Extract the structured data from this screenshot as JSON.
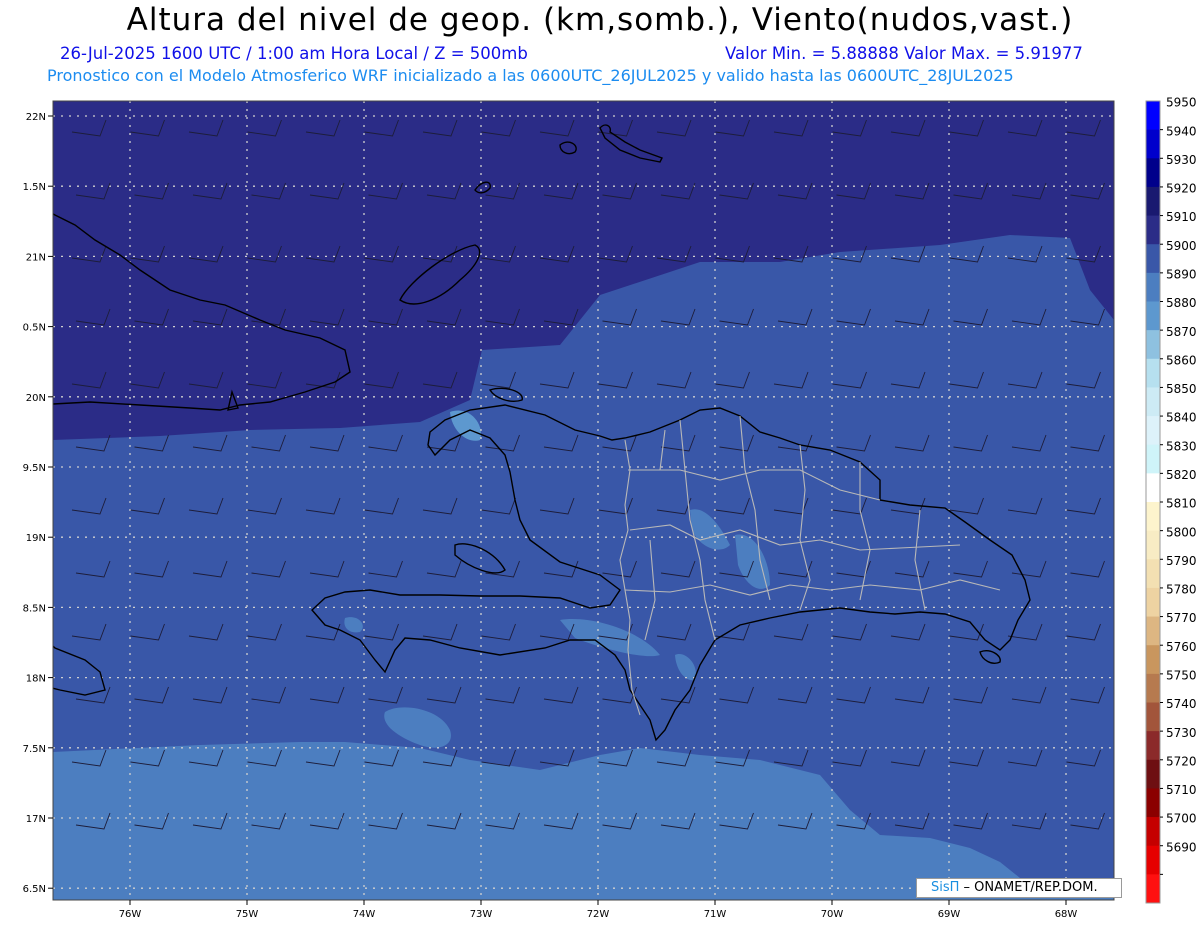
{
  "header": {
    "title": "Altura del nivel de geop. (km,somb.), Viento(nudos,vast.)",
    "line1_left": "26-Jul-2025   1600 UTC / 1:00 am Hora Local / Z = 500mb",
    "line1_right": "Valor Min. = 5.88888  Valor Max. = 5.91977",
    "line2": "Pronostico con el Modelo Atmosferico WRF inicializado a las 0600UTC_26JUL2025 y valido hasta las  0600UTC_28JUL2025"
  },
  "map": {
    "lat_labels": [
      "22N",
      "1.5N",
      "21N",
      "0.5N",
      "20N",
      "9.5N",
      "19N",
      "8.5N",
      "18N",
      "7.5N",
      "17N",
      "6.5N"
    ],
    "lon_labels": [
      "76W",
      "75W",
      "74W",
      "73W",
      "72W",
      "71W",
      "70W",
      "69W",
      "68W"
    ],
    "colors": {
      "level_5910": "#2b2c87",
      "level_5900": "#3957a8",
      "level_5890": "#4c7ec0",
      "level_5880": "#5d98cf",
      "coastline": "#000000",
      "provinces": "#b8b8b8",
      "grid": "#d0d0d0"
    }
  },
  "colorbar": {
    "labels": [
      "5950",
      "5940",
      "5930",
      "5920",
      "5910",
      "5900",
      "5890",
      "5880",
      "5870",
      "5860",
      "5850",
      "5840",
      "5830",
      "5820",
      "5810",
      "5800",
      "5790",
      "5780",
      "5770",
      "5760",
      "5750",
      "5740",
      "5730",
      "5720",
      "5710",
      "5700",
      "5690"
    ],
    "colors": [
      "#0000ff",
      "#0000cc",
      "#00008b",
      "#191970",
      "#2b2c87",
      "#3957a8",
      "#4c7ec0",
      "#5d98cf",
      "#8ec1e0",
      "#b6e0ef",
      "#cdebf5",
      "#ddf2fa",
      "#cff4f9",
      "#ffffff",
      "#fdf4cd",
      "#f8ecc4",
      "#f3e0b2",
      "#eed3a2",
      "#ddb682",
      "#c9965e",
      "#b67a4f",
      "#a2553b",
      "#8b2a2a",
      "#6e0f12",
      "#8b0000",
      "#c50000",
      "#e60000",
      "#ff1010"
    ]
  },
  "credit": {
    "logo": "SisΠ",
    "text": " – ONAMET/REP.DOM."
  }
}
